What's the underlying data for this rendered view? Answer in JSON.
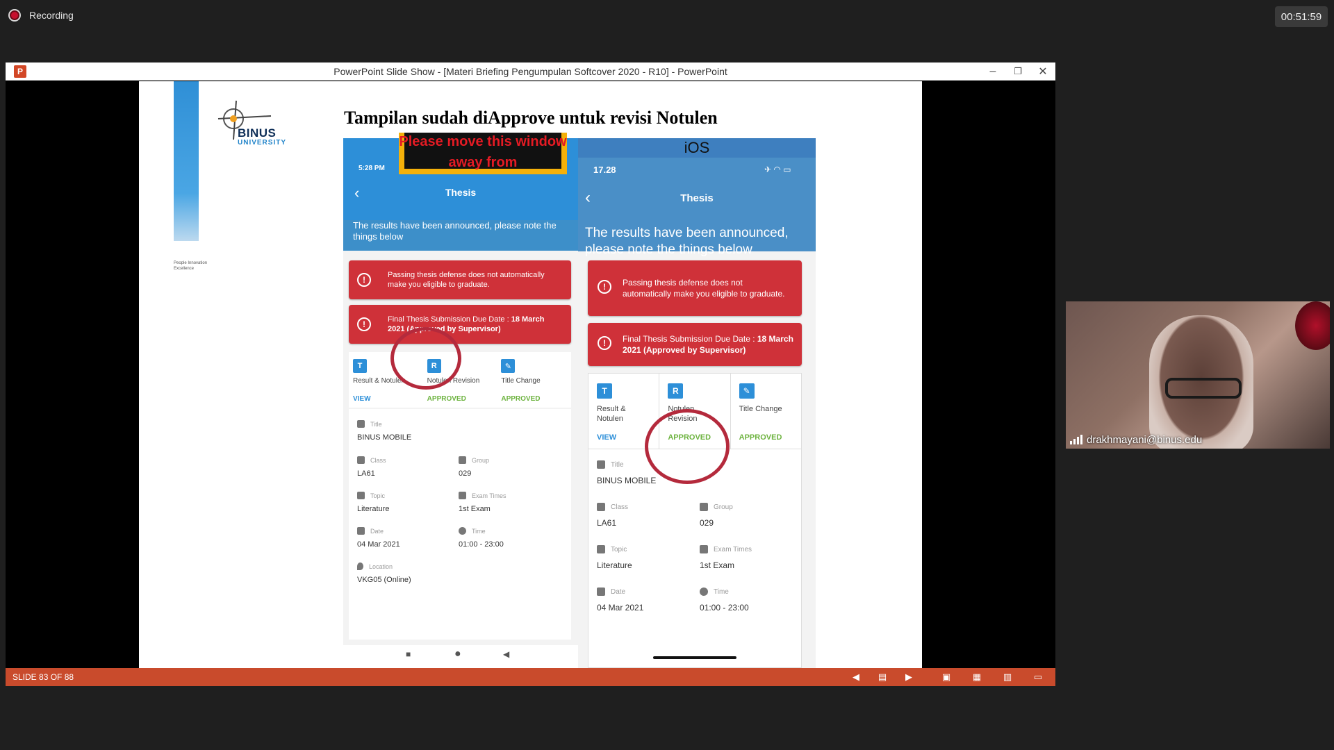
{
  "meeting": {
    "recording_label": "Recording",
    "timer": "00:51:59",
    "participant_name": "drakhmayani@binus.edu"
  },
  "powerpoint": {
    "window_title": "PowerPoint Slide Show - [Materi Briefing Pengumpulan Softcover 2020 - R10] - PowerPoint",
    "app_icon": "P",
    "minimize": "–",
    "restore": "❐",
    "close": "✕",
    "slide_counter": "SLIDE 83 OF 88"
  },
  "slide": {
    "heading": "Tampilan sudah diApprove untuk revisi Notulen",
    "logo_name": "BINUS",
    "logo_sub": "UNIVERSITY",
    "strip_text": "People Innovation Excellence",
    "overlay_text": "Please move this window away from",
    "android": {
      "status_time": "5:28 PM",
      "back": "‹",
      "title": "Thesis",
      "banner": "The results have been announced, please note the things below",
      "alert1": "Passing thesis defense does not automatically make you eligible to graduate.",
      "alert2_a": "Final Thesis Submission Due Date : ",
      "alert2_b": "18 March 2021 (Approved by Supervisor)",
      "tile1_label": "Result & Notulen",
      "tile1_status": "VIEW",
      "tile2_label": "Notulen Revision",
      "tile2_status": "APPROVED",
      "tile3_label": "Title Change",
      "tile3_status": "APPROVED",
      "title_lbl": "Title",
      "title_val": "BINUS MOBILE",
      "class_lbl": "Class",
      "class_val": "LA61",
      "group_lbl": "Group",
      "group_val": "029",
      "topic_lbl": "Topic",
      "topic_val": "Literature",
      "exam_lbl": "Exam Times",
      "exam_val": "1st Exam",
      "date_lbl": "Date",
      "date_val": "04 Mar 2021",
      "time_lbl": "Time",
      "time_val": "01:00 - 23:00",
      "location_lbl": "Location",
      "location_val": "VKG05 (Online)",
      "nav_square": "■",
      "nav_circle": "●",
      "nav_back": "◀"
    },
    "ios": {
      "label": "iOS",
      "status_time": "17.28",
      "status_icons": "✈ ◠ ▭",
      "back": "‹",
      "title": "Thesis",
      "banner": "The results have been announced, please note the things below",
      "alert1": "Passing thesis defense does not automatically make you eligible to graduate.",
      "alert2_a": "Final Thesis Submission Due Date : ",
      "alert2_b": "18 March 2021 (Approved by Supervisor)",
      "tile1_label": "Result & Notulen",
      "tile1_status": "VIEW",
      "tile2_label": "Notulen Revision",
      "tile2_status": "APPROVED",
      "tile3_label": "Title Change",
      "tile3_status": "APPROVED",
      "title_lbl": "Title",
      "title_val": "BINUS MOBILE",
      "class_lbl": "Class",
      "class_val": "LA61",
      "group_lbl": "Group",
      "group_val": "029",
      "topic_lbl": "Topic",
      "topic_val": "Literature",
      "exam_lbl": "Exam Times",
      "exam_val": "1st Exam",
      "date_lbl": "Date",
      "date_val": "04 Mar 2021",
      "time_lbl": "Time",
      "time_val": "01:00 - 23:00"
    }
  },
  "statusbar_icons": {
    "prev": "◀",
    "notes": "▤",
    "next": "▶",
    "normal_view": "▣",
    "sorter_view": "▦",
    "reading_view": "▥",
    "slideshow_view": "▭"
  },
  "colors": {
    "alert_red": "#cf3139",
    "app_blue": "#2d8fd8",
    "approved_green": "#6db33f",
    "ppt_orange": "#c94b2c"
  }
}
